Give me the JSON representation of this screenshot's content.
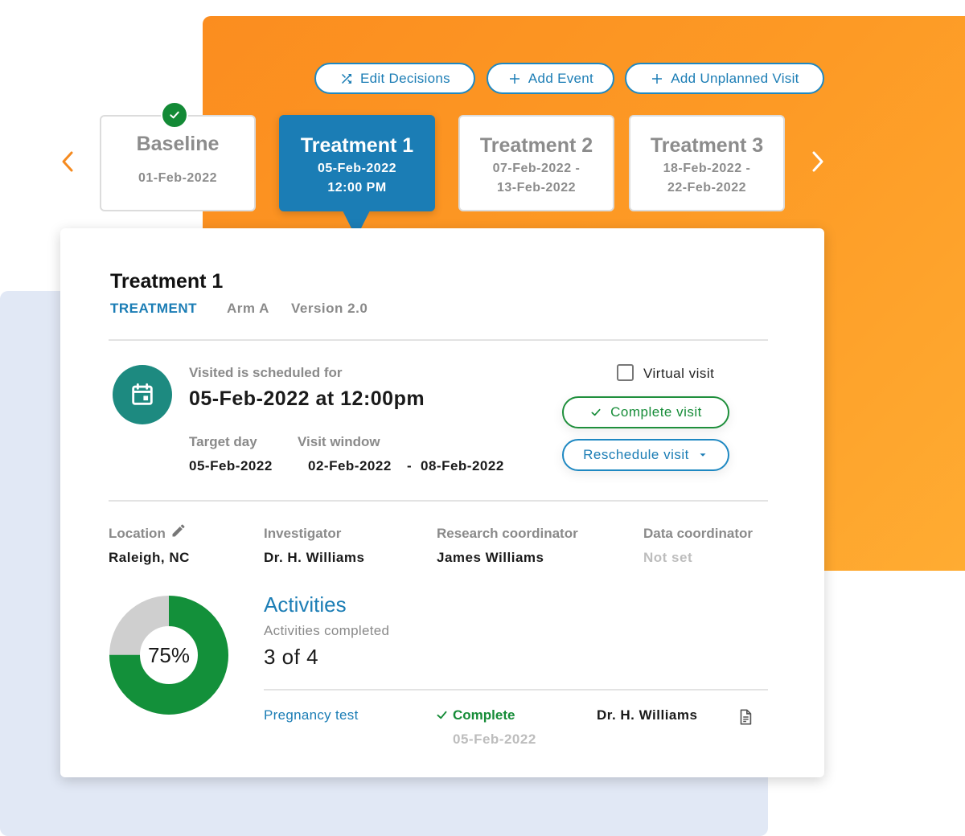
{
  "toolbar": {
    "edit_decisions": "Edit Decisions",
    "add_event": "Add Event",
    "add_unplanned_visit": "Add Unplanned Visit"
  },
  "visits": [
    {
      "title": "Baseline",
      "line1": "01-Feb-2022",
      "line2": "",
      "status": "complete"
    },
    {
      "title": "Treatment 1",
      "line1": "05-Feb-2022",
      "line2": "12:00 PM",
      "status": "active"
    },
    {
      "title": "Treatment 2",
      "line1": "07-Feb-2022 -",
      "line2": "13-Feb-2022",
      "status": "upcoming"
    },
    {
      "title": "Treatment 3",
      "line1": "18-Feb-2022 -",
      "line2": "22-Feb-2022",
      "status": "upcoming"
    }
  ],
  "detail": {
    "title": "Treatment 1",
    "type": "TREATMENT",
    "arm": "Arm A",
    "version": "Version 2.0",
    "scheduled_label": "Visited is scheduled for",
    "scheduled_value": "05-Feb-2022 at 12:00pm",
    "target_day_label": "Target day",
    "target_day_value": "05-Feb-2022",
    "visit_window_label": "Visit window",
    "visit_window_start": "02-Feb-2022",
    "visit_window_sep": "-",
    "visit_window_end": "08-Feb-2022",
    "virtual_visit_label": "Virtual visit",
    "virtual_visit_checked": false,
    "complete_visit_label": "Complete visit",
    "reschedule_visit_label": "Reschedule visit"
  },
  "people": {
    "location_label": "Location",
    "location_value": "Raleigh, NC",
    "investigator_label": "Investigator",
    "investigator_value": "Dr. H. Williams",
    "research_label": "Research coordinator",
    "research_value": "James Williams",
    "data_label": "Data coordinator",
    "data_value": "Not set"
  },
  "activities": {
    "title": "Activities",
    "completed_label": "Activities completed",
    "completed_count": "3 of 4",
    "percent_label": "75%",
    "completed_fraction": 0.75,
    "rows": [
      {
        "name": "Pregnancy test",
        "status": "Complete",
        "date": "05-Feb-2022",
        "by": "Dr. H. Williams"
      }
    ]
  },
  "colors": {
    "accent_blue": "#1b7db5",
    "accent_orange": "#fd9a25",
    "success_green": "#138a36",
    "teal": "#1d8a80",
    "donut_grey": "#cfcfcf"
  }
}
